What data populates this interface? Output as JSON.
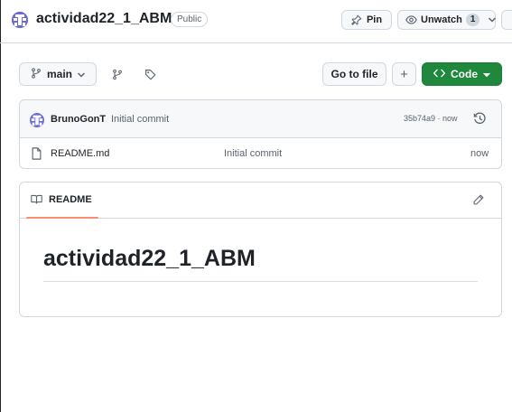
{
  "repo": {
    "name": "actividad22_1_ABM",
    "visibility": "Public"
  },
  "header_actions": {
    "pin_label": "Pin",
    "unwatch_label": "Unwatch",
    "watch_count": "1"
  },
  "toolbar": {
    "branch": "main",
    "go_to_file_label": "Go to file",
    "add_label": "+",
    "code_label": "Code"
  },
  "latest_commit": {
    "author": "BrunoGonT",
    "message": "Initial commit",
    "sha_time": "35b74a9 · now"
  },
  "files": [
    {
      "name": "README.md",
      "commit_message": "Initial commit",
      "time": "now"
    }
  ],
  "readme": {
    "tab_label": "README",
    "heading": "actividad22_1_ABM"
  },
  "colors": {
    "accent_green": "#1f883d",
    "tab_underline": "#fd8c73",
    "avatar": "#6b6bd1"
  },
  "icons": [
    "repo-avatar-icon",
    "pin-icon",
    "eye-icon",
    "chevron-down-icon",
    "branch-icon",
    "tag-icon",
    "code-icon",
    "history-icon",
    "file-icon",
    "book-icon",
    "pencil-icon"
  ]
}
